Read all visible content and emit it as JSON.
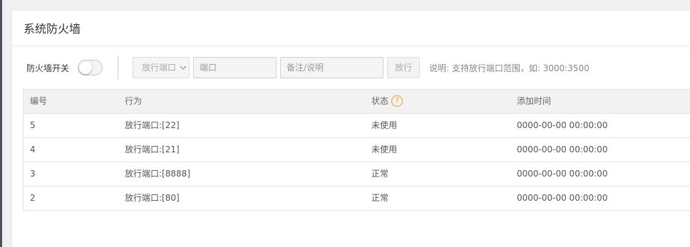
{
  "panel": {
    "title": "系统防火墙"
  },
  "toolbar": {
    "switch_label": "防火墙开关",
    "switch_on": false,
    "select_value": "放行端口",
    "port_placeholder": "端口",
    "note_placeholder": "备注/说明",
    "allow_button": "放行",
    "hint": "说明: 支持放行端口范围，如: 3000:3500"
  },
  "table": {
    "headers": {
      "id": "编号",
      "action": "行为",
      "status": "状态",
      "status_help_icon": "?",
      "added_time": "添加时间"
    },
    "rows": [
      {
        "id": "5",
        "action": "放行端口:[22]",
        "status": "未使用",
        "added_time": "0000-00-00 00:00:00"
      },
      {
        "id": "4",
        "action": "放行端口:[21]",
        "status": "未使用",
        "added_time": "0000-00-00 00:00:00"
      },
      {
        "id": "3",
        "action": "放行端口:[8888]",
        "status": "正常",
        "added_time": "0000-00-00 00:00:00"
      },
      {
        "id": "2",
        "action": "放行端口:[80]",
        "status": "正常",
        "added_time": "0000-00-00 00:00:00"
      }
    ]
  },
  "colors": {
    "help_icon": "#f29b1a",
    "left_rail": "#4b5361"
  }
}
